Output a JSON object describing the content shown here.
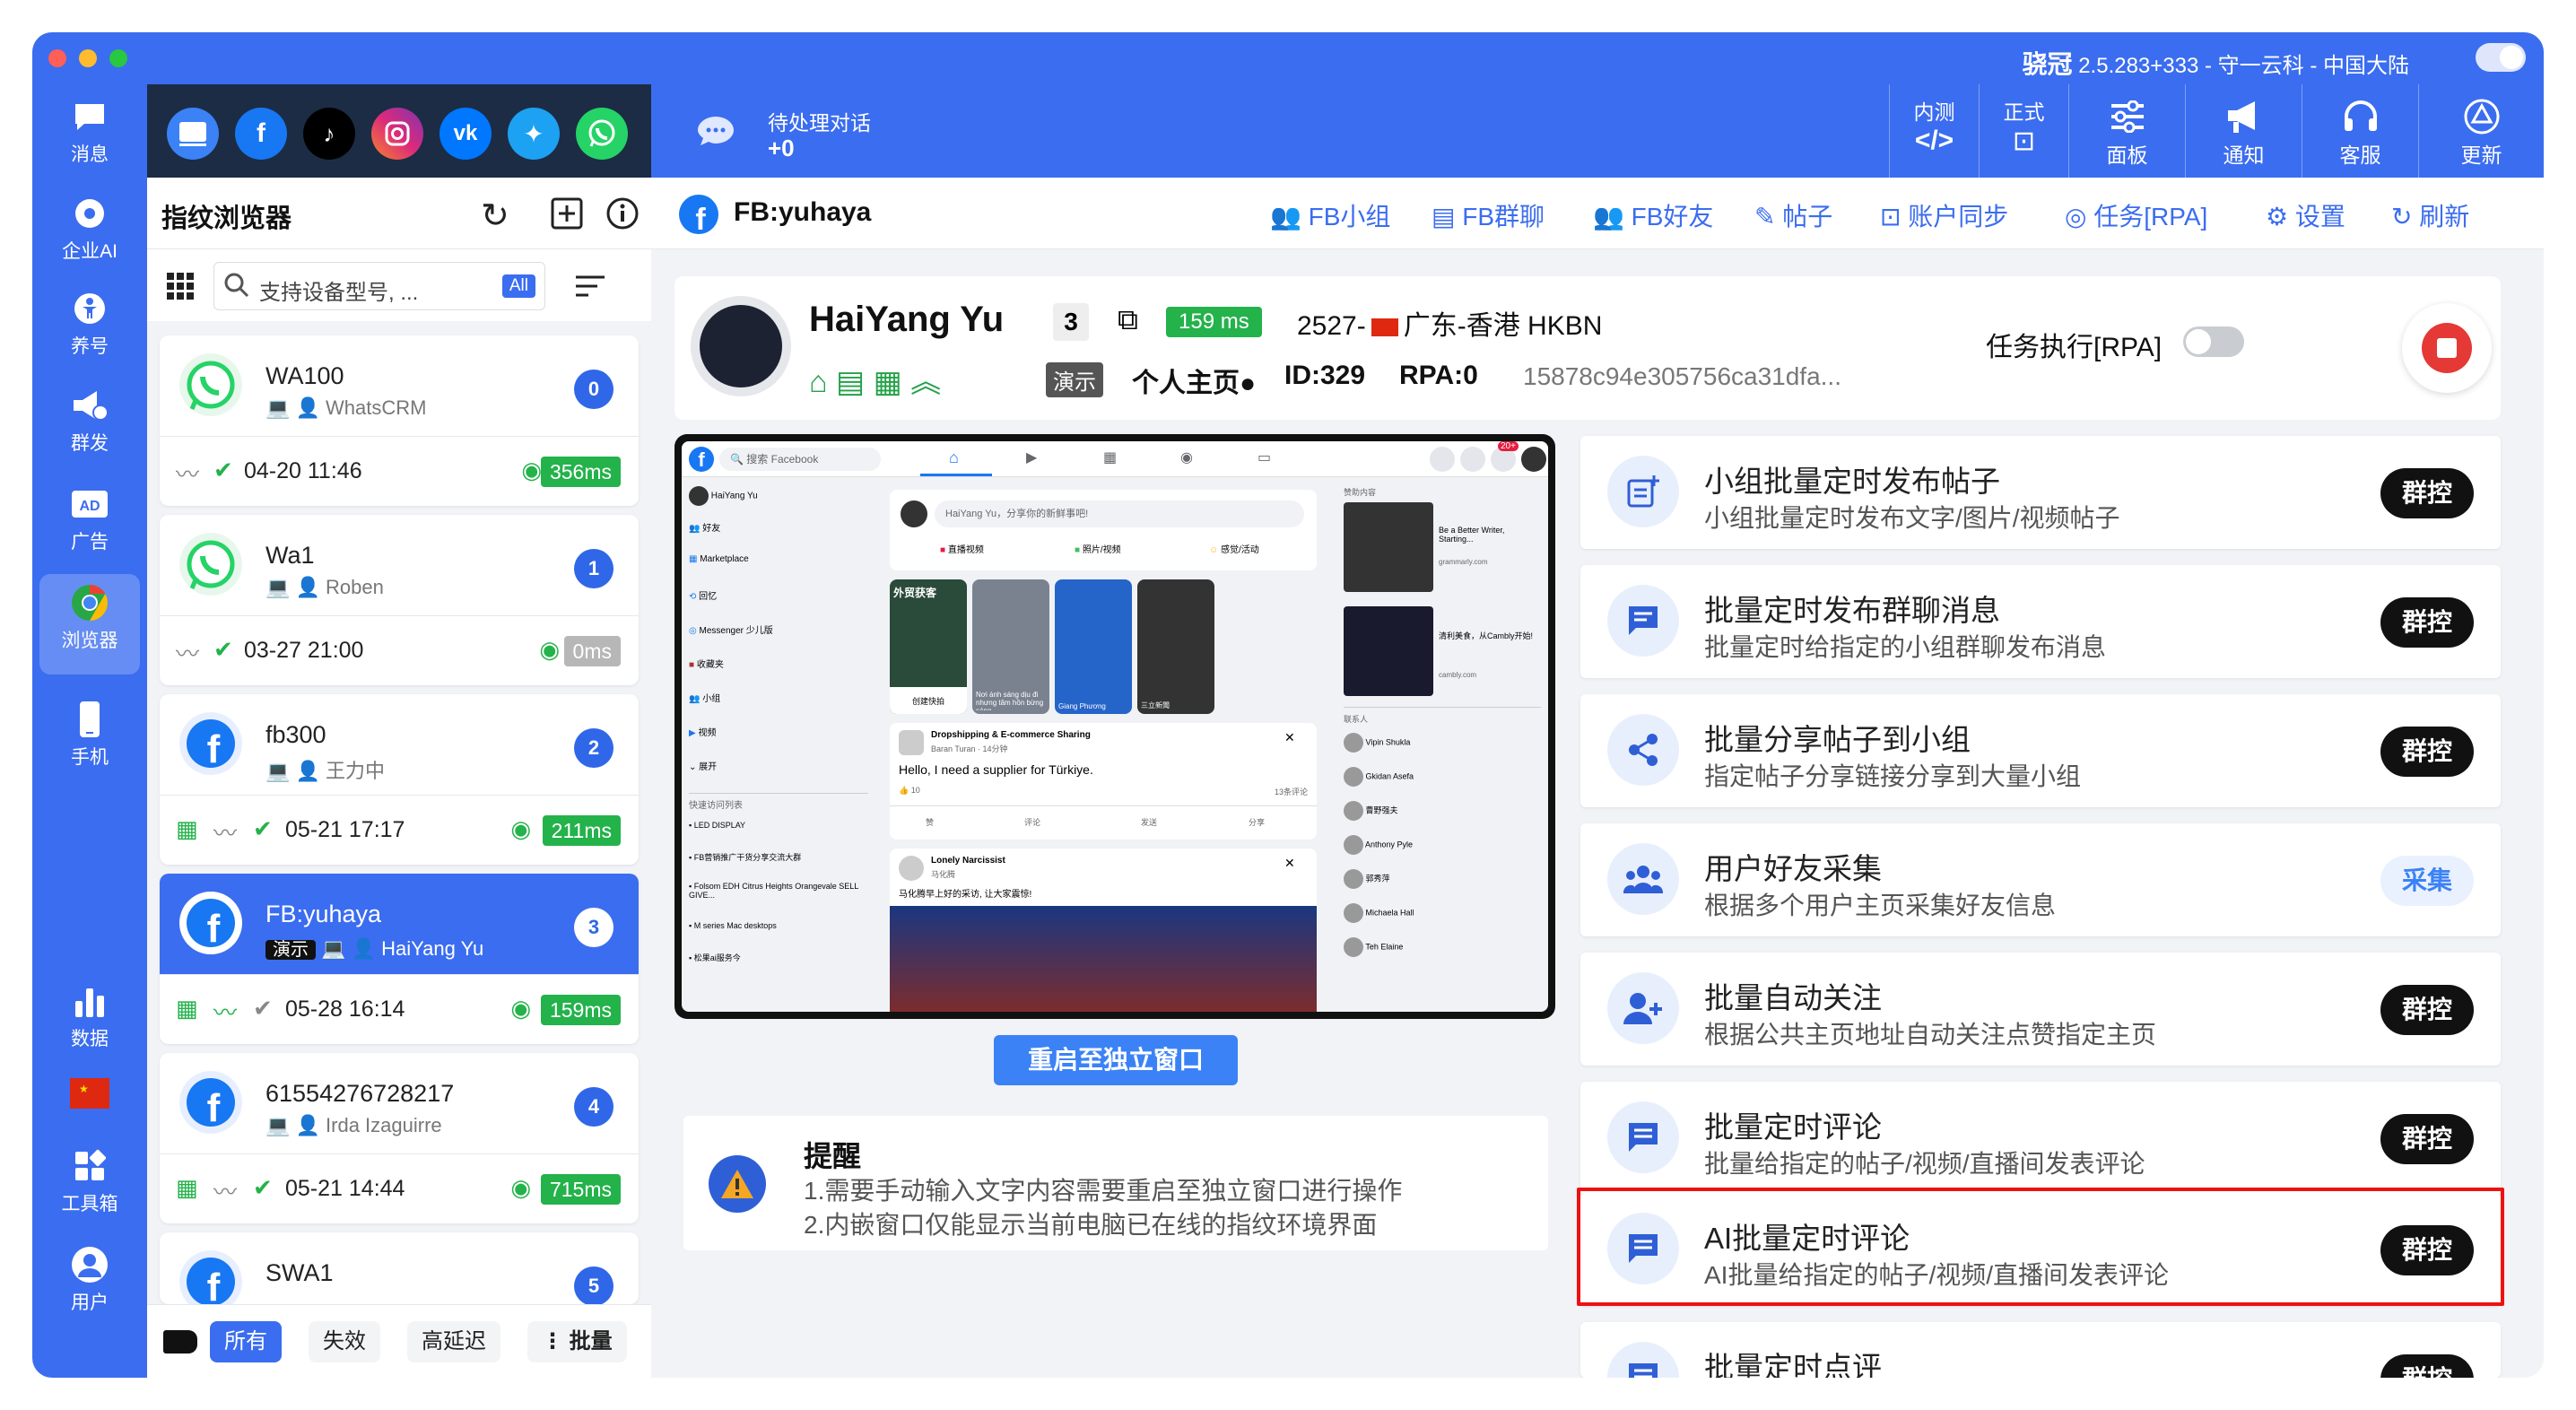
{
  "titlebar": {
    "brand": "骁冠",
    "info": " 2.5.283+333 - 守一云科 - 中国大陆"
  },
  "left_nav": [
    {
      "name": "nav-messages",
      "icon": "chat-icon",
      "label": "消息"
    },
    {
      "name": "nav-enterprise-ai",
      "icon": "ai-icon",
      "label": "企业AI"
    },
    {
      "name": "nav-account-raise",
      "icon": "person-icon",
      "label": "养号"
    },
    {
      "name": "nav-mass-send",
      "icon": "megaphone-icon",
      "label": "群发"
    },
    {
      "name": "nav-ads",
      "icon": "ad-icon",
      "label": "广告"
    },
    {
      "name": "nav-browser",
      "icon": "chrome-icon",
      "label": "浏览器"
    },
    {
      "name": "nav-phone",
      "icon": "phone-icon",
      "label": "手机"
    },
    {
      "name": "nav-data",
      "icon": "bar-chart-icon",
      "label": "数据"
    },
    {
      "name": "nav-toolbox",
      "icon": "toolbox-icon",
      "label": "工具箱"
    },
    {
      "name": "nav-user",
      "icon": "user-icon",
      "label": "用户"
    }
  ],
  "social_icons": [
    "browser-icon",
    "facebook-icon",
    "tiktok-icon",
    "instagram-icon",
    "vk-icon",
    "twitter-icon",
    "whatsapp-icon"
  ],
  "pending": {
    "label": "待处理对话",
    "count": "+0"
  },
  "top_right": [
    {
      "name": "internal-test",
      "line1": "内测",
      "line2": "</>"
    },
    {
      "name": "official",
      "line1": "正式",
      "line2": "⊡"
    },
    {
      "name": "panel",
      "label": "面板"
    },
    {
      "name": "notify",
      "label": "通知"
    },
    {
      "name": "support",
      "label": "客服"
    },
    {
      "name": "update",
      "label": "更新"
    }
  ],
  "list_panel": {
    "title": "指纹浏览器",
    "search_placeholder": "支持设备型号, ...",
    "all_badge": "All"
  },
  "cards": [
    {
      "name": "WA100",
      "sub": "WhatsCRM",
      "num": "0",
      "date": "04-20 11:46",
      "ms": "356ms",
      "ms_color": "#24b24b",
      "platform": "whatsapp"
    },
    {
      "name": "Wa1",
      "sub": "Roben",
      "num": "1",
      "date": "03-27 21:00",
      "ms": "0ms",
      "ms_color": "#b7b7b7",
      "platform": "whatsapp"
    },
    {
      "name": "fb300",
      "sub": "王力中",
      "num": "2",
      "date": "05-21 17:17",
      "ms": "211ms",
      "ms_color": "#24b24b",
      "platform": "facebook"
    },
    {
      "name": "FB:yuhaya",
      "sub": "HaiYang Yu",
      "demo": "演示",
      "num": "3",
      "date": "05-28 16:14",
      "ms": "159ms",
      "ms_color": "#24b24b",
      "platform": "facebook"
    },
    {
      "name": "61554276728217",
      "sub": "Irda Izaguirre",
      "num": "4",
      "date": "05-21 14:44",
      "ms": "715ms",
      "ms_color": "#24b24b",
      "platform": "facebook"
    },
    {
      "name": "SWA1",
      "num": "5",
      "platform": "facebook"
    }
  ],
  "list_footer": {
    "all": "所有",
    "invalid": "失效",
    "high_latency": "高延迟",
    "batch": "批量"
  },
  "account_bar": {
    "title": "FB:yuhaya",
    "links": [
      "FB小组",
      "FB群聊",
      "FB好友",
      "帖子",
      "账户同步",
      "任务[RPA]",
      "设置",
      "刷新"
    ]
  },
  "profile": {
    "name": "HaiYang Yu",
    "count": "3",
    "latency": "159 ms",
    "location": "2527-",
    "region": "广东-香港 HKBN",
    "demo": "演示",
    "homepage": "个人主页",
    "id": "ID:329",
    "rpa": "RPA:0",
    "hash": "15878c94e305756ca31dfa...",
    "task_label": "任务执行[RPA]"
  },
  "embed_fb": {
    "search": "搜索 Facebook",
    "left_menu": [
      "HaiYang Yu",
      "好友",
      "Marketplace",
      "回忆",
      "Messenger 少儿版",
      "收藏夹",
      "小组",
      "视频",
      "展开"
    ],
    "shortcuts_title": "快速访问列表",
    "shortcuts": [
      "LED DISPLAY",
      "FB营销推广干货分享交流大群",
      "Folsom EDH Citrus Heights Orangevale SELL GIVE...",
      "M series Mac desktops",
      "松果ai服务今"
    ],
    "composer": "HaiYang Yu，分享你的新鲜事吧!",
    "composer_actions": [
      "直播视频",
      "照片/视频",
      "感觉/活动"
    ],
    "stories": [
      "外贸获客",
      "Nơi ánh sáng dịu đi nhưng tâm hồn bừng sáng...",
      "Giang Phương",
      "三立新聞"
    ],
    "story_create": "创建快拍",
    "post1_group": "Dropshipping & E-commerce Sharing",
    "post1_author": "Baran Turan · 14分钟",
    "post1_text": "Hello, I need a supplier for Türkiye.",
    "post1_likes": "10",
    "post1_comments": "13条评论",
    "post_actions": [
      "赞",
      "评论",
      "发送",
      "分享"
    ],
    "post2_group": "Lonely Narcissist",
    "post2_author": "马化腾",
    "post2_text": "马化腾早上好的采访, 让大家震惊!",
    "sponsored": "赞助内容",
    "ad1": "Be a Better Writer, Starting...",
    "ad1_src": "grammarly.com",
    "ad2": "清利美食，从Cambly开始!",
    "ad2_src": "cambly.com",
    "contacts_title": "联系人",
    "contacts": [
      "Vipin Shukla",
      "Gkidan Asefa",
      "曹野强夫",
      "Anthony Pyle",
      "郭秀萍",
      "Michaela Hall",
      "Teh Elaine"
    ],
    "badge": "20+"
  },
  "reopen_button": "重启至独立窗口",
  "reminder": {
    "title": "提醒",
    "line1": "1.需要手动输入文字内容需要重启至独立窗口进行操作",
    "line2": "2.内嵌窗口仅能显示当前电脑已在线的指纹环境界面"
  },
  "features": [
    {
      "icon": "post-icon",
      "title": "小组批量定时发布帖子",
      "desc": "小组批量定时发布文字/图片/视频帖子",
      "btn": "群控",
      "style": "dark"
    },
    {
      "icon": "message-icon",
      "title": "批量定时发布群聊消息",
      "desc": "批量定时给指定的小组群聊发布消息",
      "btn": "群控",
      "style": "dark"
    },
    {
      "icon": "share-icon",
      "title": "批量分享帖子到小组",
      "desc": "指定帖子分享链接分享到大量小组",
      "btn": "群控",
      "style": "dark"
    },
    {
      "icon": "group-icon",
      "title": "用户好友采集",
      "desc": "根据多个用户主页采集好友信息",
      "btn": "采集",
      "style": "light"
    },
    {
      "icon": "add-user-icon",
      "title": "批量自动关注",
      "desc": "根据公共主页地址自动关注点赞指定主页",
      "btn": "群控",
      "style": "dark"
    },
    {
      "icon": "comment-icon",
      "title": "批量定时评论",
      "desc": "批量给指定的帖子/视频/直播间发表评论",
      "btn": "群控",
      "style": "dark"
    },
    {
      "icon": "comment-icon",
      "title": "AI批量定时评论",
      "desc": "AI批量给指定的帖子/视频/直播间发表评论",
      "btn": "群控",
      "style": "dark"
    },
    {
      "icon": "comment-icon",
      "title": "批量定时点评",
      "desc": "",
      "btn": "群控",
      "style": "dark"
    }
  ]
}
